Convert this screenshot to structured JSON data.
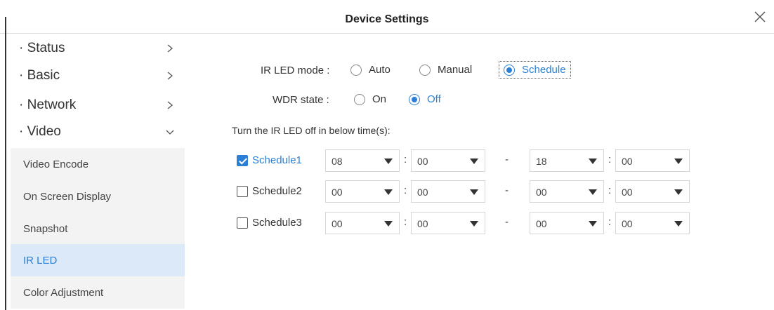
{
  "window": {
    "title": "Device Settings",
    "close_icon": "close-icon"
  },
  "sidebar": {
    "top_items": [
      {
        "label": "· Status",
        "icon": "chevron-right-icon"
      },
      {
        "label": "· Basic",
        "icon": "chevron-right-icon"
      },
      {
        "label": "· Network",
        "icon": "chevron-right-icon"
      },
      {
        "label": "· Video",
        "icon": "chevron-down-icon"
      }
    ],
    "sub_items": [
      {
        "label": "Video Encode"
      },
      {
        "label": "On Screen Display"
      },
      {
        "label": "Snapshot"
      },
      {
        "label": "IR LED",
        "active": true
      },
      {
        "label": "Color Adjustment"
      }
    ]
  },
  "ir_led": {
    "mode_label": "IR LED mode :",
    "mode_options": [
      "Auto",
      "Manual",
      "Schedule"
    ],
    "mode_selected": "Schedule",
    "wdr_label": "WDR state :",
    "wdr_options": [
      "On",
      "Off"
    ],
    "wdr_selected": "Off",
    "hint": "Turn the IR LED off in below time(s):",
    "schedules": [
      {
        "label": "Schedule1",
        "checked": true,
        "start_hour": "08",
        "start_min": "00",
        "end_hour": "18",
        "end_min": "00"
      },
      {
        "label": "Schedule2",
        "checked": false,
        "start_hour": "00",
        "start_min": "00",
        "end_hour": "00",
        "end_min": "00"
      },
      {
        "label": "Schedule3",
        "checked": false,
        "start_hour": "00",
        "start_min": "00",
        "end_hour": "00",
        "end_min": "00"
      }
    ],
    "time_sep": ":",
    "range_sep": "-"
  },
  "colors": {
    "accent": "#2b7fd6",
    "active_bg": "#dbe9f8",
    "sub_bg": "#f3f3f3"
  }
}
